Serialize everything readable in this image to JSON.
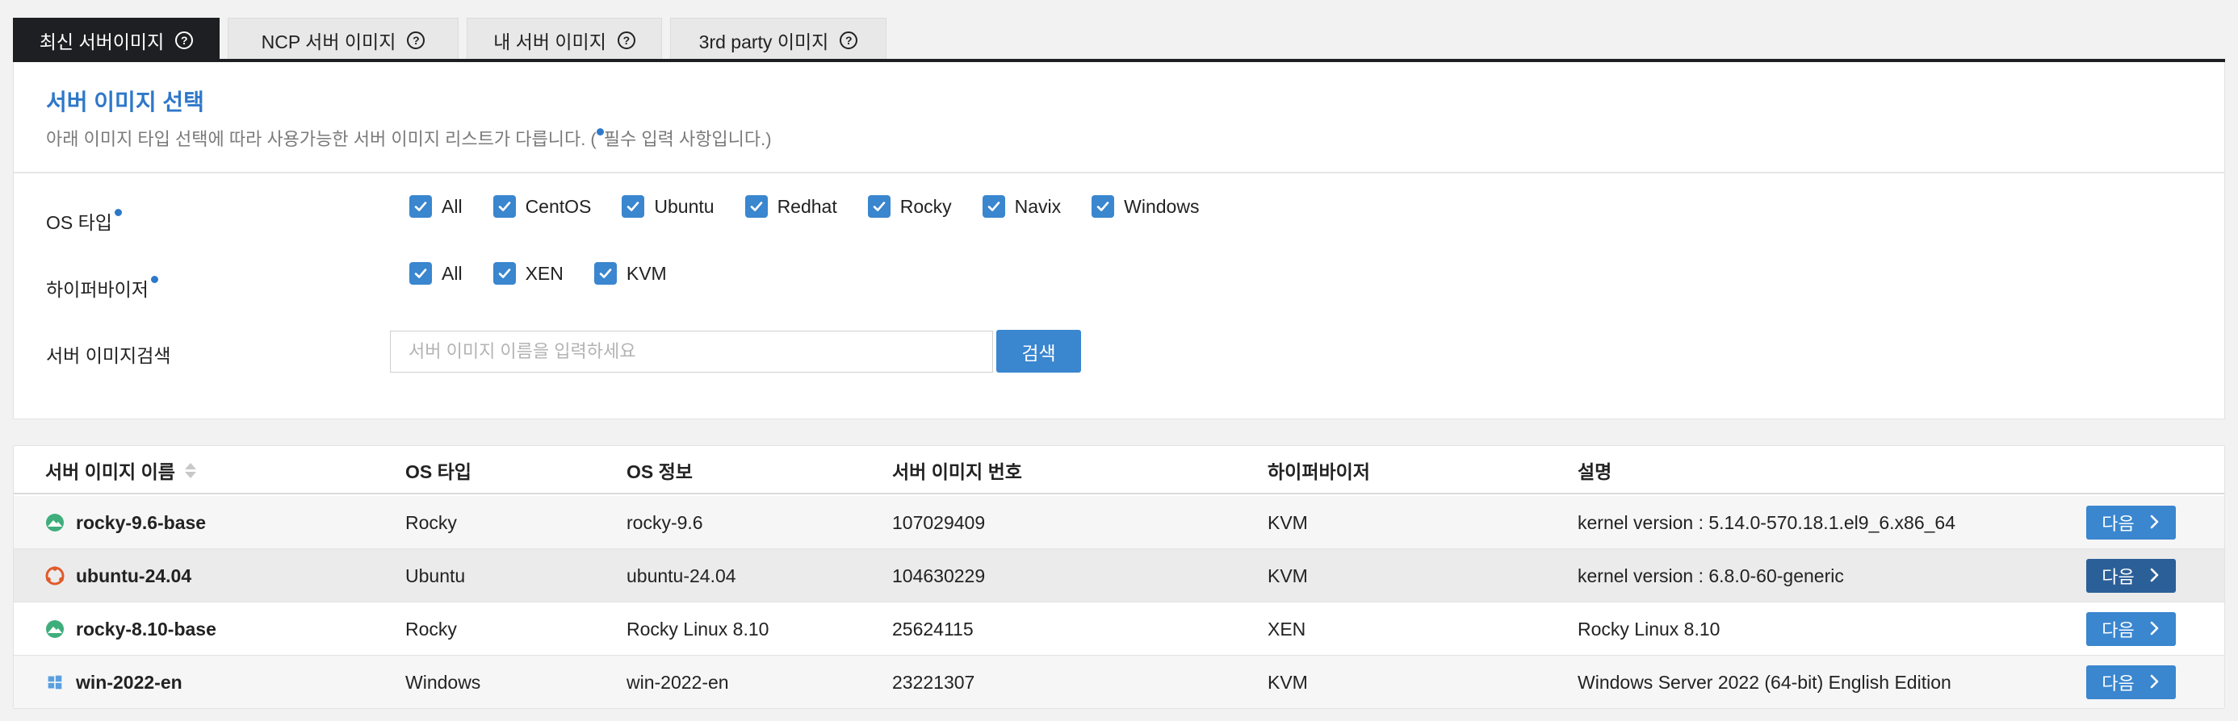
{
  "tabs": [
    {
      "label": "최신 서버이미지",
      "active": true
    },
    {
      "label": "NCP 서버 이미지",
      "active": false
    },
    {
      "label": "내 서버 이미지",
      "active": false
    },
    {
      "label": "3rd party 이미지",
      "active": false
    }
  ],
  "panel": {
    "title": "서버 이미지 선택",
    "desc_prefix": "아래 이미지 타입 선택에 따라 사용가능한 서버 이미지 리스트가 다릅니다. (",
    "desc_suffix": "필수 입력 사항입니다.)"
  },
  "filters": {
    "os_type": {
      "label": "OS 타입",
      "options": [
        "All",
        "CentOS",
        "Ubuntu",
        "Redhat",
        "Rocky",
        "Navix",
        "Windows"
      ]
    },
    "hypervisor": {
      "label": "하이퍼바이저",
      "options": [
        "All",
        "XEN",
        "KVM"
      ]
    },
    "search": {
      "label": "서버 이미지검색",
      "placeholder": "서버 이미지 이름을 입력하세요",
      "button": "검색"
    }
  },
  "table": {
    "headers": [
      "서버 이미지 이름",
      "OS 타입",
      "OS 정보",
      "서버 이미지 번호",
      "하이퍼바이저",
      "설명"
    ],
    "rows": [
      {
        "name": "rocky-9.6-base",
        "os_type": "Rocky",
        "os_info": "rocky-9.6",
        "image_no": "107029409",
        "hypervisor": "KVM",
        "desc": "kernel version : 5.14.0-570.18.1.el9_6.x86_64",
        "icon": "rocky-icon",
        "action": "다음"
      },
      {
        "name": "ubuntu-24.04",
        "os_type": "Ubuntu",
        "os_info": "ubuntu-24.04",
        "image_no": "104630229",
        "hypervisor": "KVM",
        "desc": "kernel version : 6.8.0-60-generic",
        "icon": "ubuntu-icon",
        "action": "다음"
      },
      {
        "name": "rocky-8.10-base",
        "os_type": "Rocky",
        "os_info": "Rocky Linux 8.10",
        "image_no": "25624115",
        "hypervisor": "XEN",
        "desc": "Rocky Linux 8.10",
        "icon": "rocky-icon",
        "action": "다음"
      },
      {
        "name": "win-2022-en",
        "os_type": "Windows",
        "os_info": "win-2022-en",
        "image_no": "23221307",
        "hypervisor": "KVM",
        "desc": "Windows Server 2022 (64-bit) English Edition",
        "icon": "windows-icon",
        "action": "다음"
      }
    ]
  },
  "colors": {
    "accent": "#3a86cf",
    "title": "#2e78c9",
    "active_tab": "#1d1f22",
    "rocky": "#3fae7c",
    "ubuntu": "#e05a2b",
    "windows": "#5aa0e0"
  }
}
